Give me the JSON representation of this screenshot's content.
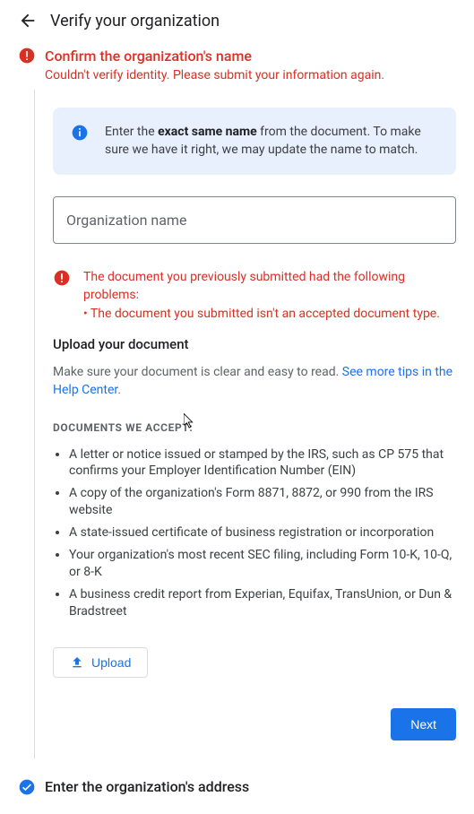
{
  "header": {
    "title": "Verify your organization"
  },
  "step1": {
    "heading": "Confirm the organization's name",
    "sub": "Couldn't verify identity. Please submit your information again."
  },
  "info": {
    "prefix": "Enter the ",
    "bold": "exact same name",
    "suffix": " from the document. To make sure we have it right, we may update the name to match."
  },
  "org_input": {
    "placeholder": "Organization name"
  },
  "doc_error": {
    "line1": "The document you previously submitted had the following problems:",
    "line2": "• The document you submitted isn't an accepted document type."
  },
  "upload_section": {
    "label": "Upload your document",
    "tip_prefix": "Make sure your document is clear and easy to read. ",
    "tip_link": "See more tips in the Help Center",
    "accept_label": "DOCUMENTS WE ACCEPT:",
    "items": [
      "A letter or notice issued or stamped by the IRS, such as CP 575 that confirms your Employer Identification Number (EIN)",
      "A copy of the organization's Form 8871, 8872, or 990 from the IRS website",
      "A state-issued certificate of business registration or incorporation",
      "Your organization's most recent SEC filing, including Form 10-K, 10-Q, or 8-K",
      "A business credit report from Experian, Equifax, TransUnion, or Dun & Bradstreet"
    ],
    "upload_btn": "Upload",
    "next_btn": "Next"
  },
  "step2": {
    "heading": "Enter the organization's address"
  }
}
